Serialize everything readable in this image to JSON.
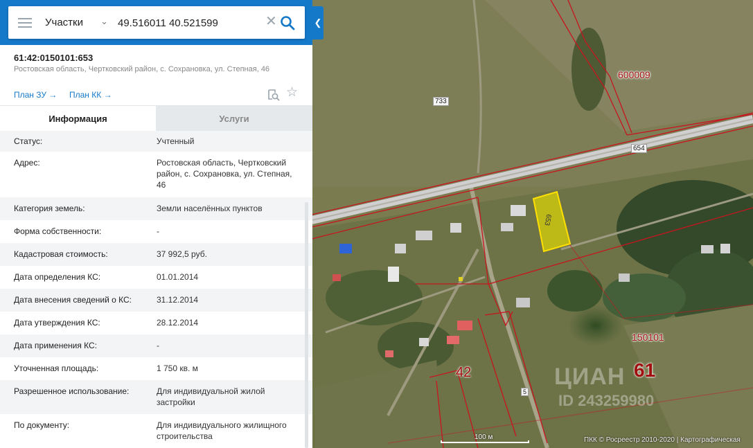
{
  "search": {
    "type_label": "Участки",
    "query": "49.516011 40.521599"
  },
  "parcel": {
    "number": "61:42:0150101:653",
    "address": "Ростовская область, Чертковский район, с. Сохрановка, ул. Степная, 46",
    "plan_zu": "План ЗУ →",
    "plan_kk": "План КК →"
  },
  "tabs": {
    "info": "Информация",
    "services": "Услуги"
  },
  "info": [
    {
      "label": "Статус:",
      "value": "Учтенный"
    },
    {
      "label": "Адрес:",
      "value": "Ростовская область, Чертковский район, с. Сохрановка, ул. Степная, 46"
    },
    {
      "label": "Категория земель:",
      "value": "Земли населённых пунктов"
    },
    {
      "label": "Форма собственности:",
      "value": "-"
    },
    {
      "label": "Кадастровая стоимость:",
      "value": "37 992,5 руб."
    },
    {
      "label": "Дата определения КС:",
      "value": "01.01.2014"
    },
    {
      "label": "Дата внесения сведений о КС:",
      "value": "31.12.2014"
    },
    {
      "label": "Дата утверждения КС:",
      "value": "28.12.2014"
    },
    {
      "label": "Дата применения КС:",
      "value": "-"
    },
    {
      "label": "Уточненная площадь:",
      "value": "1 750 кв. м"
    },
    {
      "label": "Разрешенное использование:",
      "value": "Для индивидуальной жилой застройки"
    },
    {
      "label": "По документу:",
      "value": "Для индивидуального жилищного строительства"
    }
  ],
  "map": {
    "labels": {
      "p733": "733",
      "p654": "654",
      "p600009": "600009",
      "p653": "653",
      "p150101": "150101",
      "p42": "42",
      "p61": "61",
      "p5": "5"
    },
    "watermark": "ЦИАН",
    "watermark_id": "ID 243259980",
    "scale": "100 м",
    "copyright": "ПКК © Росреестр 2010-2020 | Картографическая"
  },
  "colors": {
    "accent": "#1579c9",
    "boundary": "#c8141e",
    "selected_parcel": "#e8e000"
  }
}
